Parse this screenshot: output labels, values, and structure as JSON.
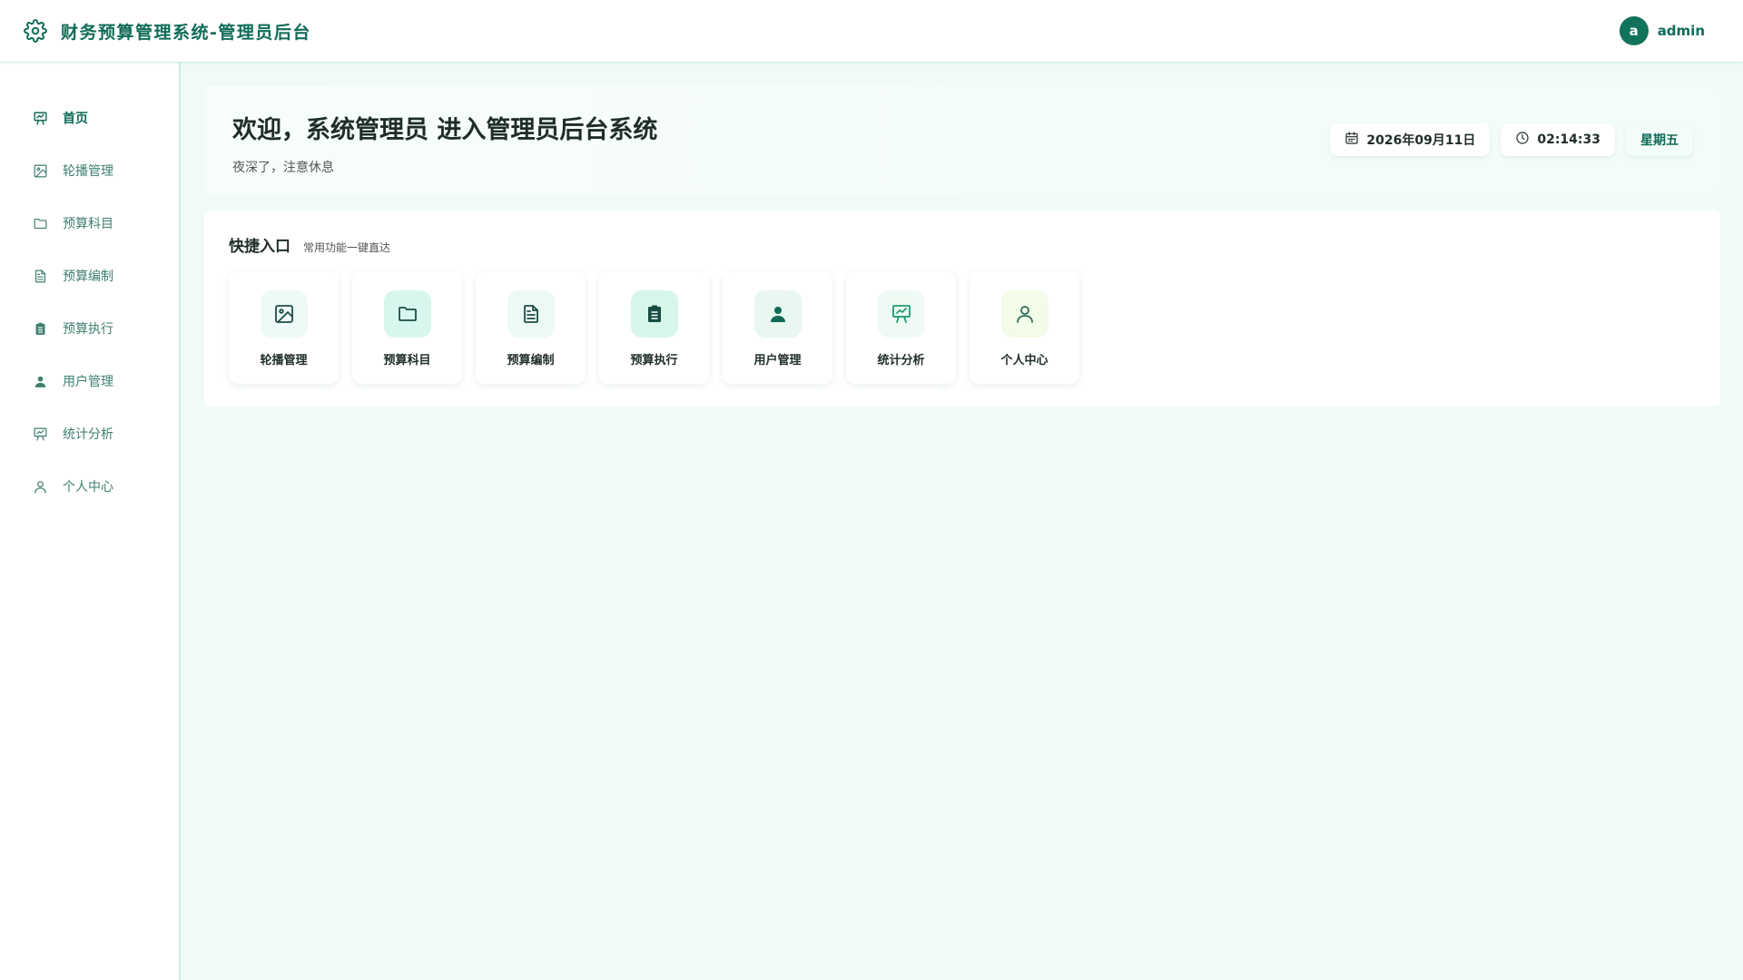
{
  "header": {
    "title": "财务预算管理系统-管理员后台",
    "user": {
      "avatar_letter": "a",
      "name": "admin"
    }
  },
  "sidebar": {
    "items": [
      {
        "label": "首页",
        "icon": "presentation-icon",
        "active": true
      },
      {
        "label": "轮播管理",
        "icon": "image-icon",
        "active": false
      },
      {
        "label": "预算科目",
        "icon": "folder-icon",
        "active": false
      },
      {
        "label": "预算编制",
        "icon": "document-icon",
        "active": false
      },
      {
        "label": "预算执行",
        "icon": "clipboard-icon",
        "active": false
      },
      {
        "label": "用户管理",
        "icon": "user-icon",
        "active": false
      },
      {
        "label": "统计分析",
        "icon": "presentation-icon",
        "active": false
      },
      {
        "label": "个人中心",
        "icon": "user-outline-icon",
        "active": false
      }
    ]
  },
  "welcome": {
    "title": "欢迎，系统管理员 进入管理员后台系统",
    "subtitle": "夜深了，注意休息",
    "date": "2026年09月11日",
    "time": "02:14:33",
    "weekday": "星期五"
  },
  "quick": {
    "title": "快捷入口",
    "subtitle": "常用功能一键直达",
    "items": [
      {
        "label": "轮播管理",
        "icon": "image-icon",
        "bg": "#eefaf7"
      },
      {
        "label": "预算科目",
        "icon": "folder-icon",
        "bg": "#d7f6ee"
      },
      {
        "label": "预算编制",
        "icon": "document-icon",
        "bg": "#ecfaf6"
      },
      {
        "label": "预算执行",
        "icon": "clipboard-icon",
        "bg": "#d7f6ea"
      },
      {
        "label": "用户管理",
        "icon": "user-icon",
        "bg": "#e8f7f0"
      },
      {
        "label": "统计分析",
        "icon": "presentation-icon",
        "bg": "#eefaf3"
      },
      {
        "label": "个人中心",
        "icon": "user-outline-icon",
        "bg": "#f3fbe9"
      }
    ]
  },
  "colors": {
    "accent": "#0f6b57",
    "background": "#f0fbf8",
    "avatar": "#11735c"
  }
}
